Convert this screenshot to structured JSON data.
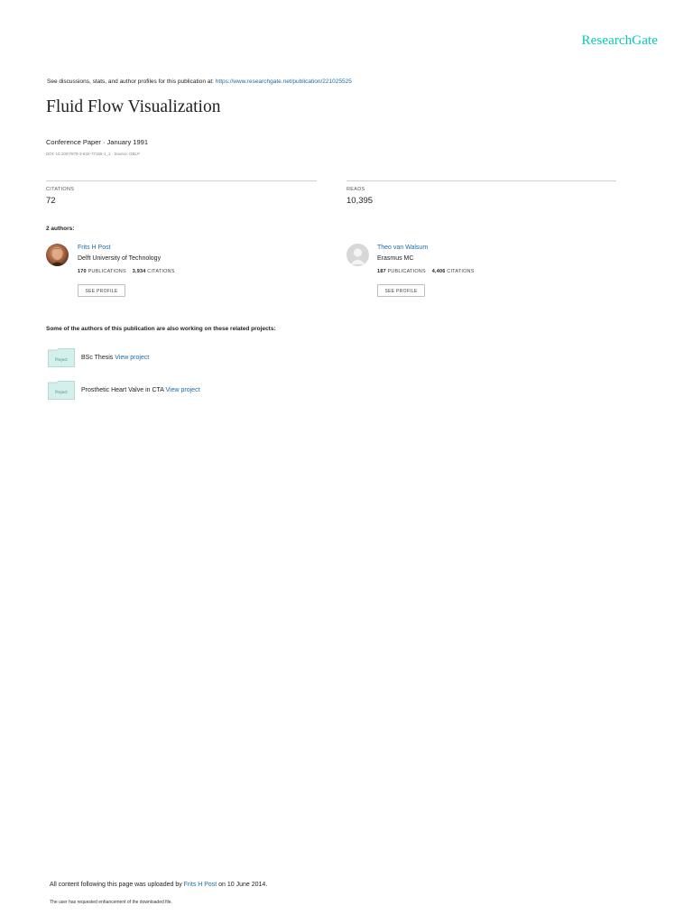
{
  "brand": {
    "logo_text": "ResearchGate",
    "accent": "#00ccbb",
    "link": "#1c6aa5"
  },
  "header": {
    "discussion_text": "See discussions, stats, and author profiles for this publication at: ",
    "publication_url": "https://www.researchgate.net/publication/221025525"
  },
  "publication": {
    "title": "Fluid Flow Visualization",
    "type_date": "Conference Paper · January 1991",
    "doi_source": "DOI: 10.1007/978-3-642-77165-1_1 · Source: DBLP"
  },
  "stats": {
    "citations_label": "CITATIONS",
    "citations_value": "72",
    "reads_label": "READS",
    "reads_value": "10,395"
  },
  "authors_label": "2 authors:",
  "authors": [
    {
      "name": "Frits H Post",
      "institution": "Delft University of Technology",
      "publications": "170",
      "publications_label": "PUBLICATIONS",
      "citations": "3,934",
      "citations_label": "CITATIONS",
      "see_profile": "SEE PROFILE",
      "avatar": "photo"
    },
    {
      "name": "Theo van Walsum",
      "institution": "Erasmus MC",
      "publications": "187",
      "publications_label": "PUBLICATIONS",
      "citations": "4,406",
      "citations_label": "CITATIONS",
      "see_profile": "SEE PROFILE",
      "avatar": "placeholder"
    }
  ],
  "related_label": "Some of the authors of this publication are also working on these related projects:",
  "projects": [
    {
      "icon_label": "Project",
      "name": "BSc Thesis",
      "link_text": "View project"
    },
    {
      "icon_label": "Project",
      "name": "Prosthetic Heart Valve in CTA",
      "link_text": "View project"
    }
  ],
  "footer": {
    "uploaded_prefix": "All content following this page was uploaded by ",
    "uploader": "Frits H Post",
    "uploaded_suffix": " on 10 June 2014.",
    "enhancement_note": "The user has requested enhancement of the downloaded file."
  }
}
